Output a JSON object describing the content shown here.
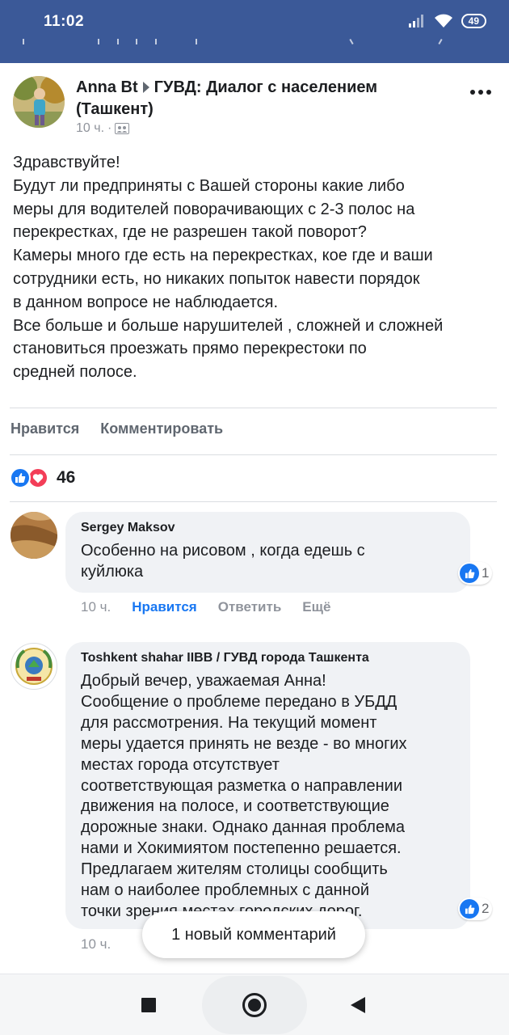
{
  "status_bar": {
    "time": "11:02",
    "battery": "49"
  },
  "post": {
    "author": "Anna Bt",
    "group": "ГУВД: Диалог с населением (Ташкент)",
    "time": "10 ч.",
    "text_lines": [
      "Здравствуйте!",
      "Будут ли предприняты с Вашей стороны какие либо",
      "меры для водителей поворачивающих с 2-3 полос на",
      "перекрестках, где не разрешен такой поворот?",
      "Камеры много где есть на перекрестках, кое где и ваши",
      "сотрудники есть, но никаких попыток навести порядок",
      "в данном вопросе не наблюдается.",
      "Все больше и больше нарушителей , сложней и сложней",
      "становиться проезжать прямо перекрестоки по",
      "средней полосе."
    ],
    "actions": {
      "like": "Нравится",
      "comment": "Комментировать"
    },
    "reaction_count": "46"
  },
  "comments": [
    {
      "author": "Sergey Maksov",
      "text_lines": [
        "Особенно на рисовом , когда едешь с",
        "куйлюка"
      ],
      "likes": "1",
      "time": "10 ч.",
      "like_label": "Нравится",
      "reply_label": "Ответить",
      "more_label": "Ещё"
    },
    {
      "author": "Toshkent shahar IIBB / ГУВД города Ташкента",
      "text_lines": [
        "Добрый вечер, уважаемая Анна!",
        "Сообщение о проблеме передано в УБДД",
        "для рассмотрения. На текущий момент",
        "меры удается принять не везде - во многих",
        "местах города отсутствует",
        "соответствующая разметка о направлении",
        "движения на полосе, и соответствующие",
        "дорожные знаки. Однако данная проблема",
        "нами и Хокимиятом постепенно решается.",
        "Предлагаем жителям столицы сообщить",
        "нам о наиболее проблемных с данной",
        "точки зрения местах городских дорог."
      ],
      "likes": "2",
      "time": "10 ч."
    }
  ],
  "toast": "1 новый комментарий",
  "colors": {
    "status_bar": "#3b5998",
    "like_blue": "#1877f2",
    "love_red": "#f33e58",
    "bubble": "#f0f2f5"
  },
  "icons": [
    "signal-icon",
    "wifi-icon",
    "battery-icon",
    "group-icon",
    "more-icon",
    "like-icon",
    "love-icon",
    "recents-icon",
    "home-icon",
    "back-icon"
  ]
}
